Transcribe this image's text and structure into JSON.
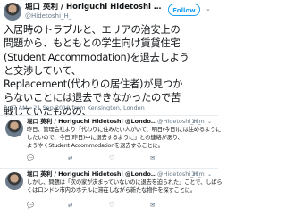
{
  "main_tweet": {
    "name": "堀口 英利 / Horiguchi Hidetoshi @L...",
    "handle": "@Hidetoshi_H_",
    "follow_label": "Follow",
    "caret": "⌄",
    "lines": [
      "入居時のトラブルと、エリアの治安上の",
      "問題から、もともとの学生向け賃貸住宅",
      "(Student Accommodation)を退去しよう",
      "と交渉していて、",
      "Replacement(代わりの居住者)が見つか",
      "らないことには退去できなかったので苦",
      "戦していたものの、"
    ],
    "meta_time": "5:47 AM - 21 Sep 2019 from",
    "meta_location": "Kensington, London"
  },
  "replies": [
    {
      "name": "堀口 英利 / Horiguchi Hidetoshi @London",
      "handle": "@Hidetoshi_H_",
      "time": "· 10m",
      "caret": "⌄",
      "lines": [
        "昨日、管理会社より「代わりに住みたい人がいて、明日(今日)には住めるように",
        "したいので、今日(昨日)中に退去するように」との連絡があり、",
        "ようやくStudent Accommodationを退去することに。"
      ]
    },
    {
      "name": "堀口 英利 / Horiguchi Hidetoshi @London",
      "handle": "@Hidetoshi_H_",
      "time": "· 10m",
      "caret": "⌄",
      "lines": [
        "しかし、問題は「次の家が決まっていないのに退去を迫られた」ことで、しばら",
        "くはロンドン市内のホテルに滞在しながら新たな物件を探すことに。"
      ]
    }
  ],
  "icons": {
    "reply": "💬",
    "retweet": "⇄",
    "like": "♡",
    "dm": "✉"
  }
}
